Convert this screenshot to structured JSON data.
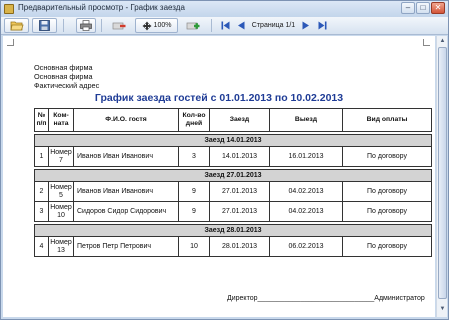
{
  "window": {
    "title": "Предварительный просмотр - График заезда",
    "controls": {
      "minimize": "–",
      "maximize": "□",
      "close": "✕"
    }
  },
  "toolbar": {
    "buttons": [
      {
        "name": "open-icon",
        "label": ""
      },
      {
        "name": "save-icon",
        "label": ""
      },
      {
        "name": "print-icon",
        "label": ""
      },
      {
        "name": "zoom-out-icon",
        "label": ""
      },
      {
        "name": "zoom-100-button",
        "label": "100%"
      },
      {
        "name": "zoom-in-icon",
        "label": ""
      },
      {
        "name": "first-page-icon",
        "label": ""
      },
      {
        "name": "prev-page-icon",
        "label": ""
      },
      {
        "name": "next-page-icon",
        "label": ""
      },
      {
        "name": "last-page-icon",
        "label": ""
      }
    ],
    "zoom_label": "100%",
    "page_indicator": "Страница 1/1"
  },
  "report": {
    "company_lines": [
      "Основная фирма",
      "Основная фирма",
      "Фактический адрес"
    ],
    "title": "График заезда гостей с 01.01.2013 по 10.02.2013",
    "columns": [
      "№ п/п",
      "Ком- ната",
      "Ф.И.О. гостя",
      "Кол-во дней",
      "Заезд",
      "Выезд",
      "Вид оплаты"
    ],
    "groups": [
      {
        "label": "Заезд 14.01.2013",
        "rows": [
          {
            "n": "1",
            "room": "Номер 7",
            "guest": "Иванов Иван Иванович",
            "days": "3",
            "checkin": "14.01.2013",
            "checkout": "16.01.2013",
            "payment": "По договору"
          }
        ]
      },
      {
        "label": "Заезд 27.01.2013",
        "rows": [
          {
            "n": "2",
            "room": "Номер 5",
            "guest": "Иванов Иван Иванович",
            "days": "9",
            "checkin": "27.01.2013",
            "checkout": "04.02.2013",
            "payment": "По договору"
          },
          {
            "n": "3",
            "room": "Номер 10",
            "guest": "Сидоров Сидор Сидорович",
            "days": "9",
            "checkin": "27.01.2013",
            "checkout": "04.02.2013",
            "payment": "По договору"
          }
        ]
      },
      {
        "label": "Заезд 28.01.2013",
        "rows": [
          {
            "n": "4",
            "room": "Номер 13",
            "guest": "Петров Петр Петрович",
            "days": "10",
            "checkin": "28.01.2013",
            "checkout": "06.02.2013",
            "payment": "По договору"
          }
        ]
      }
    ],
    "signature": "Директор______________________________Администратор"
  },
  "colors": {
    "title_blue": "#1f3c96",
    "group_gray": "#d3d3d3",
    "chrome_blue": "#c9d9ec"
  }
}
